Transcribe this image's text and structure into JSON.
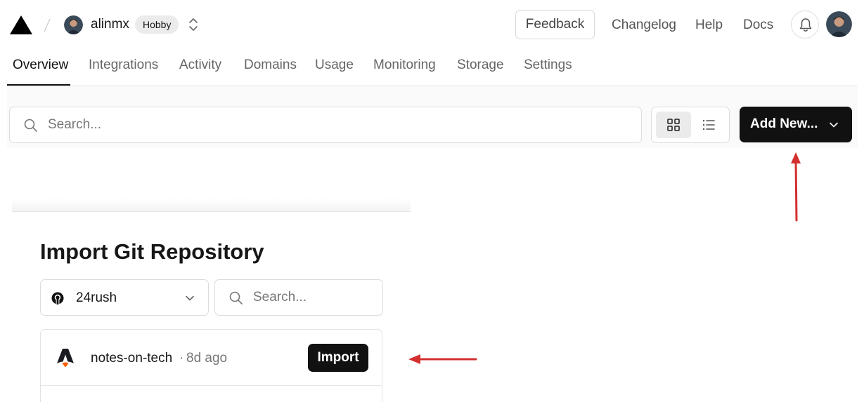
{
  "header": {
    "team_name": "alinmx",
    "plan_badge": "Hobby",
    "feedback_label": "Feedback",
    "links": [
      "Changelog",
      "Help",
      "Docs"
    ]
  },
  "tabs": [
    {
      "label": "Overview",
      "active": true
    },
    {
      "label": "Integrations",
      "active": false
    },
    {
      "label": "Activity",
      "active": false
    },
    {
      "label": "Domains",
      "active": false
    },
    {
      "label": "Usage",
      "active": false
    },
    {
      "label": "Monitoring",
      "active": false
    },
    {
      "label": "Storage",
      "active": false
    },
    {
      "label": "Settings",
      "active": false
    }
  ],
  "toolbar": {
    "search_placeholder": "Search...",
    "view_modes": [
      "grid",
      "list"
    ],
    "selected_view": "grid",
    "add_new_label": "Add New..."
  },
  "import_card": {
    "title": "Import Git Repository",
    "scope_label": "24rush",
    "search_placeholder": "Search...",
    "repos": [
      {
        "name": "notes-on-tech",
        "separator": "·",
        "time": "8d ago",
        "action_label": "Import"
      }
    ]
  },
  "icons": {
    "logo": "vercel-triangle-icon",
    "switcher": "chevron-up-down-icon",
    "notifications": "bell-icon",
    "search": "search-icon",
    "grid_view": "grid-icon",
    "list_view": "list-icon",
    "dropdown": "chevron-down-icon",
    "git_provider": "github-icon",
    "repo_framework": "astro-icon"
  },
  "colors": {
    "primary_button": "#111111",
    "active_tab": "#111111",
    "annotation_arrow": "#d32f2f"
  }
}
